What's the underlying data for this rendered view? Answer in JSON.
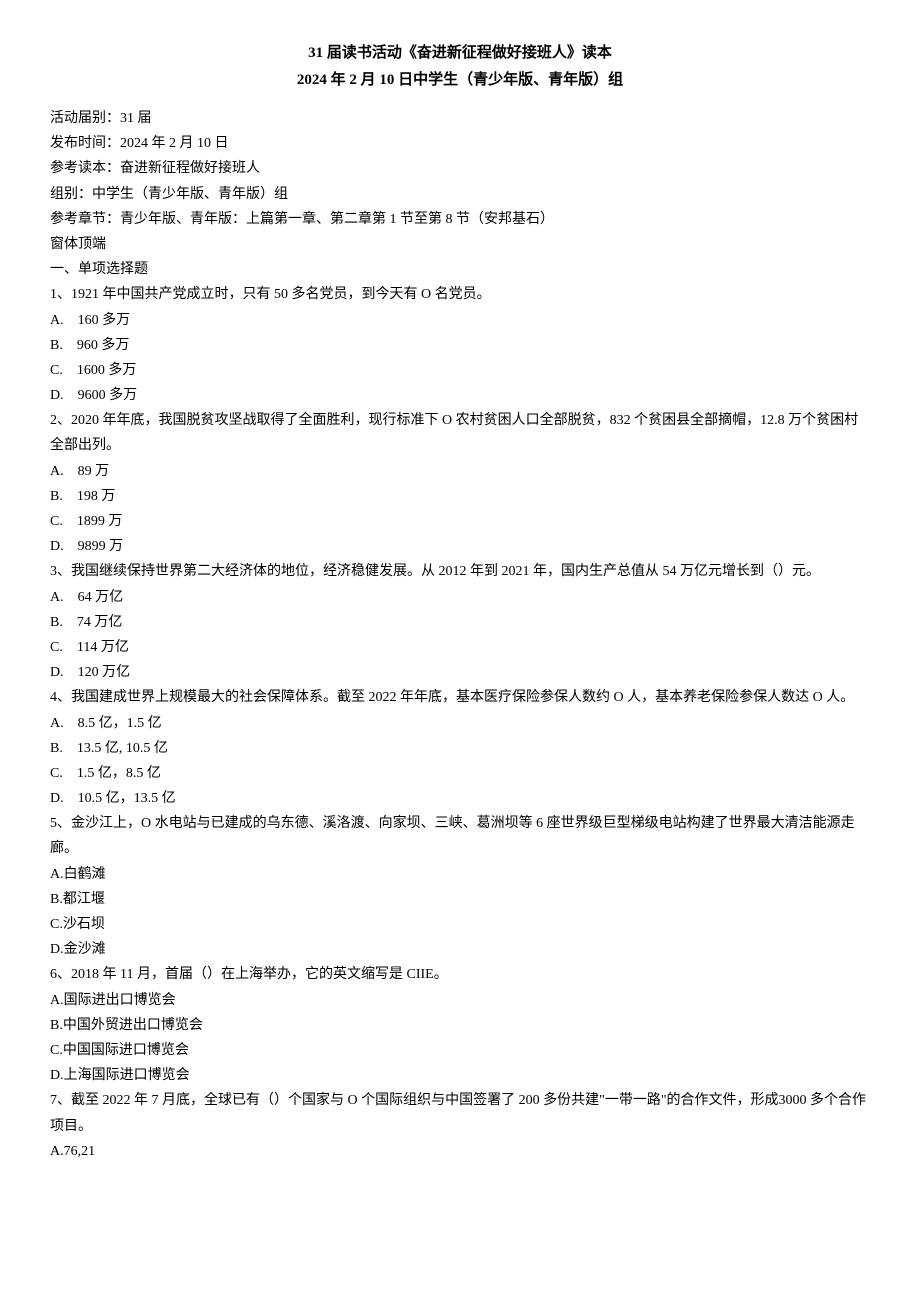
{
  "title": {
    "line1": "31 届读书活动《奋进新征程做好接班人》读本",
    "line2": "2024 年 2 月 10 日中学生（青少年版、青年版）组"
  },
  "meta": [
    "活动届别：31 届",
    "发布时间：2024 年 2 月 10 日",
    "参考读本：奋进新征程做好接班人",
    "组别：中学生（青少年版、青年版）组",
    "参考章节：青少年版、青年版：上篇第一章、第二章第 1 节至第 8 节（安邦基石）",
    "窗体顶端"
  ],
  "section_header": "一、单项选择题",
  "questions": [
    {
      "prompt": "1、1921 年中国共产党成立时，只有 50 多名党员，到今天有 O 名党员。",
      "options": [
        "A.　160 多万",
        "B.　960 多万",
        "C.　1600 多万",
        "D.　9600 多万"
      ]
    },
    {
      "prompt": "2、2020 年年底，我国脱贫攻坚战取得了全面胜利，现行标准下 O 农村贫困人口全部脱贫，832 个贫困县全部摘帽，12.8 万个贫困村全部出列。",
      "options": [
        "A.　89 万",
        "B.　198 万",
        "C.　1899 万",
        "D.　9899 万"
      ]
    },
    {
      "prompt": "3、我国继续保持世界第二大经济体的地位，经济稳健发展。从 2012 年到 2021 年，国内生产总值从 54 万亿元增长到（）元。",
      "options": [
        "A.　64 万亿",
        "B.　74 万亿",
        "C.　114 万亿",
        "D.　120 万亿"
      ]
    },
    {
      "prompt": "4、我国建成世界上规模最大的社会保障体系。截至 2022 年年底，基本医疗保险参保人数约 O 人，基本养老保险参保人数达 O 人。",
      "options": [
        "A.　8.5 亿，1.5 亿",
        "B.　13.5 亿, 10.5 亿",
        "C.　1.5 亿，8.5 亿",
        "D.　10.5 亿，13.5 亿"
      ]
    },
    {
      "prompt": "5、金沙江上，O 水电站与已建成的乌东德、溪洛渡、向家坝、三峡、葛洲坝等 6 座世界级巨型梯级电站构建了世界最大清洁能源走廊。",
      "options": [
        "A.白鹤滩",
        "B.都江堰",
        "C.沙石坝",
        "D.金沙滩"
      ]
    },
    {
      "prompt": "6、2018 年 11 月，首届（）在上海举办，它的英文缩写是 CIIE。",
      "options": [
        "A.国际进出口博览会",
        "B.中国外贸进出口博览会",
        "C.中国国际进口博览会",
        "D.上海国际进口博览会"
      ]
    },
    {
      "prompt": "7、截至 2022 年 7 月底，全球已有（）个国家与 O 个国际组织与中国签署了 200 多份共建\"一带一路\"的合作文件，形成3000 多个合作项目。",
      "options": [
        "A.76,21"
      ]
    }
  ]
}
